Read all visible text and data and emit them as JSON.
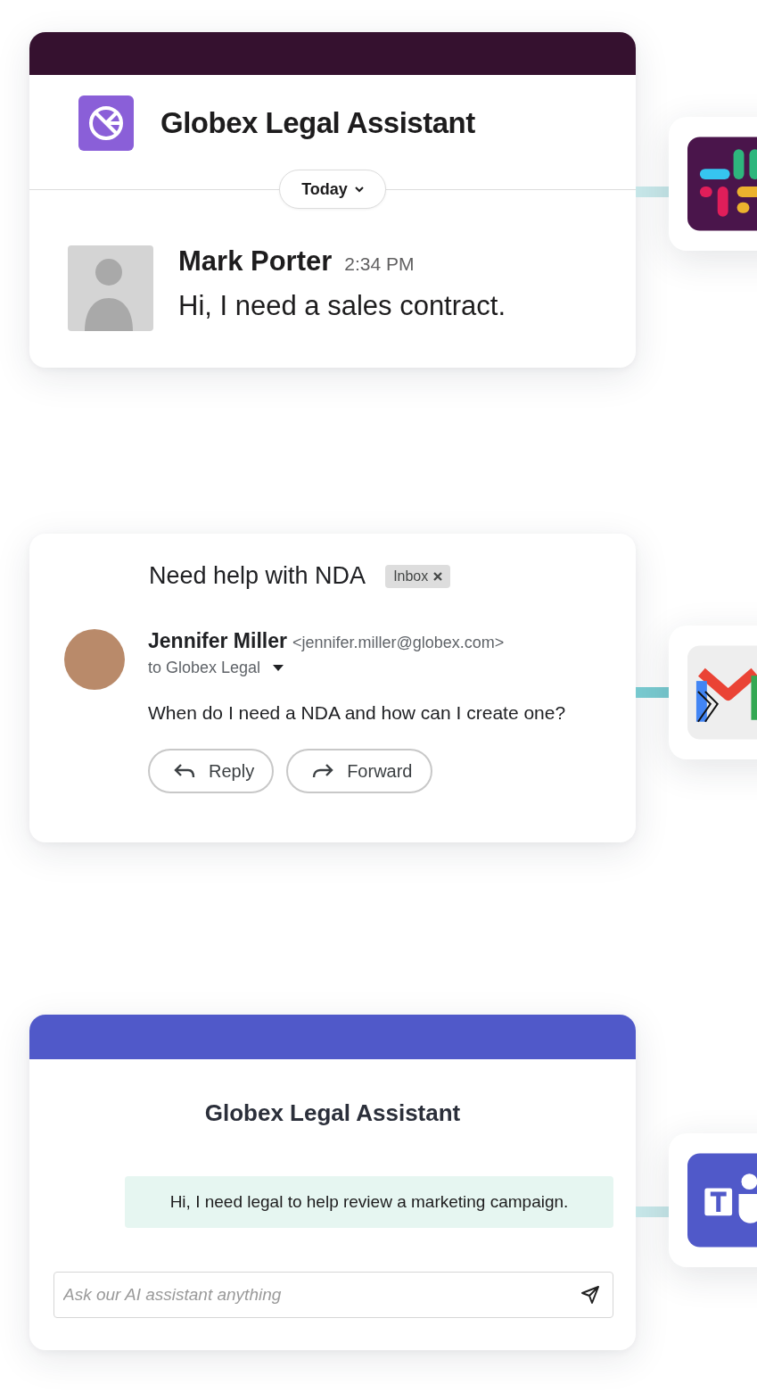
{
  "slack_card": {
    "title": "Globex Legal Assistant",
    "date_pill": "Today",
    "message": {
      "author": "Mark Porter",
      "time": "2:34 PM",
      "text": "Hi, I need a sales contract."
    }
  },
  "email_card": {
    "subject": "Need help with NDA",
    "label": "Inbox",
    "sender": {
      "name": "Jennifer Miller",
      "address": "<jennifer.miller@globex.com>"
    },
    "recipient": "to Globex Legal",
    "body": "When do I need a NDA and how can I create one?",
    "actions": [
      {
        "kind": "reply",
        "label": "Reply"
      },
      {
        "kind": "forward",
        "label": "Forward"
      }
    ]
  },
  "teams_card": {
    "title": "Globex Legal Assistant",
    "message": "Hi, I need legal to help review a marketing campaign.",
    "input": {
      "placeholder": "Ask our AI assistant anything"
    }
  }
}
